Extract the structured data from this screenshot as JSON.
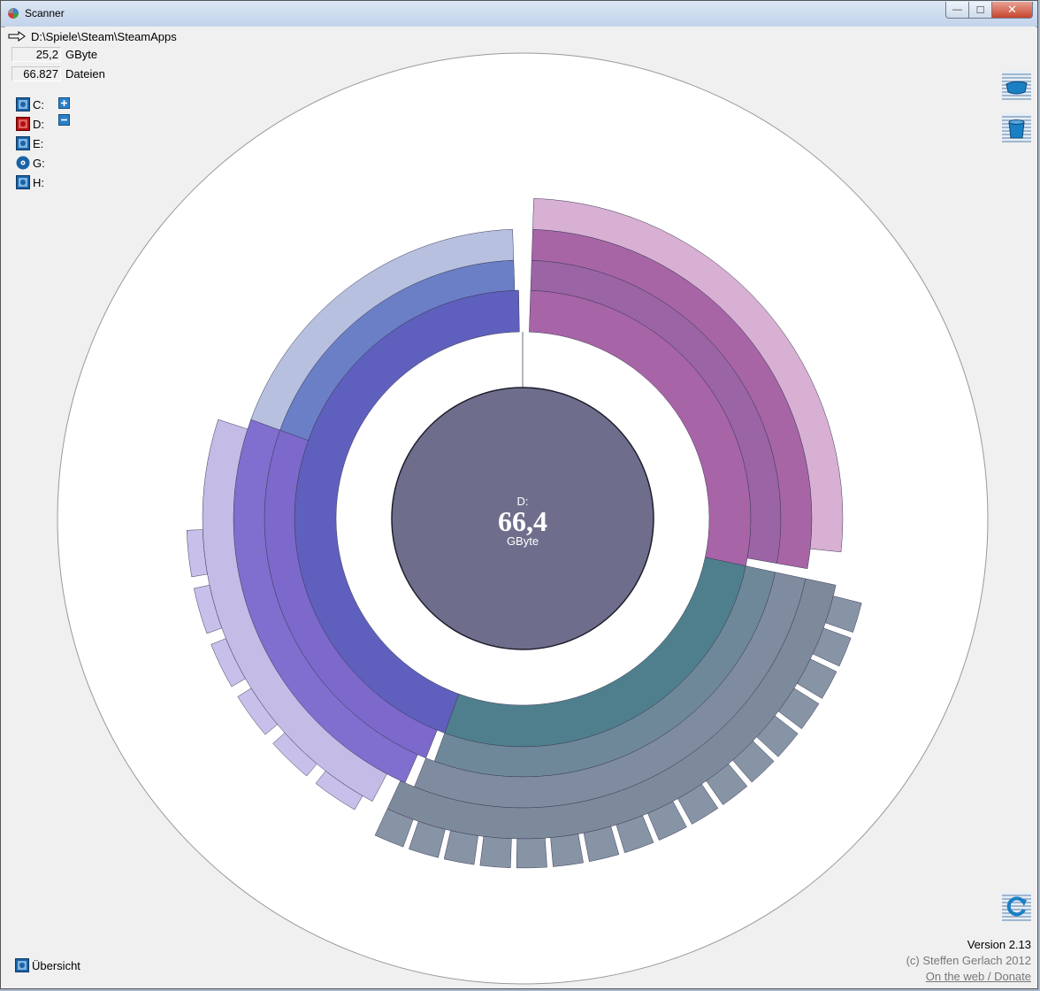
{
  "window": {
    "title": "Scanner",
    "minimize_glyph": "—",
    "maximize_glyph": "☐",
    "close_glyph": "✕"
  },
  "path": {
    "text": "D:\\Spiele\\Steam\\SteamApps"
  },
  "info": {
    "size_value": "25,2",
    "size_unit": "GByte",
    "files_value": "66.827",
    "files_unit": "Dateien"
  },
  "drives": [
    {
      "label": "C:",
      "icon": "hard-drive-icon",
      "color": "#1b63a6"
    },
    {
      "label": "D:",
      "icon": "hard-drive-error-icon",
      "color": "#b01010"
    },
    {
      "label": "E:",
      "icon": "hard-drive-icon",
      "color": "#1b63a6"
    },
    {
      "label": "G:",
      "icon": "cd-drive-icon",
      "color": "#1b63a6"
    },
    {
      "label": "H:",
      "icon": "hard-drive-icon",
      "color": "#1b63a6"
    }
  ],
  "zoom": {
    "plus_icon": "zoom-in-icon",
    "minus_icon": "zoom-out-icon"
  },
  "center": {
    "drive": "D:",
    "value": "66,4",
    "unit": "GByte"
  },
  "overview_label": "Übersicht",
  "footer": {
    "version": "Version 2.13",
    "copyright": "(c) Steffen Gerlach 2012",
    "web_link": "On the web / Donate"
  },
  "side_icons": [
    "recycle-bin-icon",
    "delete-bucket-icon",
    "refresh-icon"
  ],
  "palette": {
    "center": "#6e6e8c",
    "ring1": "#3f3f7d",
    "steam_blue": "#5f5fbd",
    "magenta": "#a764a6",
    "teal": "#4f7f8c",
    "violet": "#7f6fcc",
    "gray_blue": "#7f8c9f"
  }
}
